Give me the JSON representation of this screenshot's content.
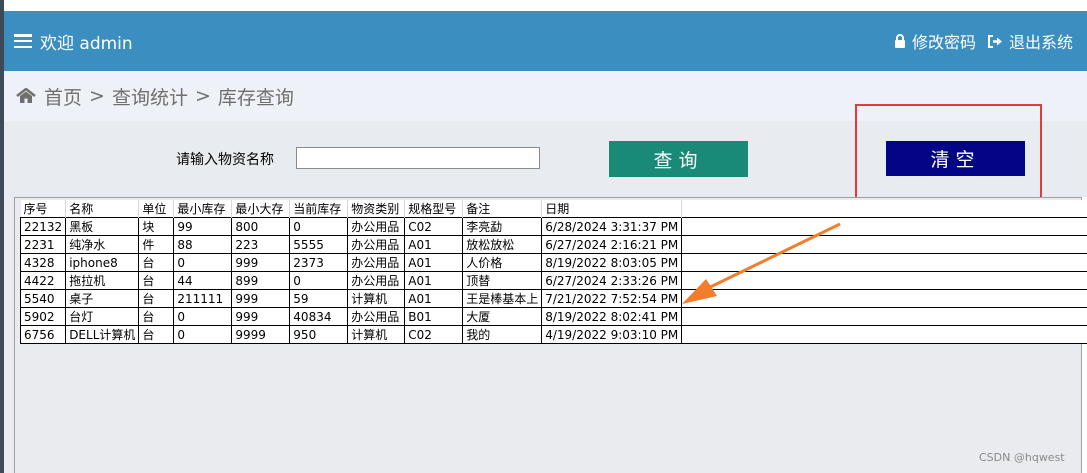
{
  "header": {
    "welcome": "欢迎 admin",
    "change_password": "修改密码",
    "logout": "退出系统"
  },
  "breadcrumb": [
    "首页",
    "查询统计",
    "库存查询"
  ],
  "breadcrumb_sep": ">",
  "search": {
    "label": "请输入物资名称",
    "value": "",
    "placeholder": "",
    "query_label": "查询",
    "clear_label": "清空"
  },
  "table": {
    "headers": [
      "序号",
      "名称",
      "单位",
      "最小库存",
      "最小大存",
      "当前库存",
      "物资类别",
      "规格型号",
      "备注",
      "日期"
    ],
    "rows": [
      [
        "22132",
        "黑板",
        "块",
        "99",
        "800",
        "0",
        "办公用品",
        "C02",
        "李亮勐",
        "6/28/2024 3:31:37 PM"
      ],
      [
        "2231",
        "纯净水",
        "件",
        "88",
        "223",
        "5555",
        "办公用品",
        "A01",
        "放松放松",
        "6/27/2024 2:16:21 PM"
      ],
      [
        "4328",
        "iphone8",
        "台",
        "0",
        "999",
        "2373",
        "办公用品",
        "A01",
        "人价格",
        "8/19/2022 8:03:05 PM"
      ],
      [
        "4422",
        "拖拉机",
        "台",
        "44",
        "899",
        "0",
        "办公用品",
        "A01",
        "顶替",
        "6/27/2024 2:33:26 PM"
      ],
      [
        "5540",
        "桌子",
        "台",
        "211111",
        "999",
        "59",
        "计算机",
        "A01",
        "王是棒基本上",
        "7/21/2022 7:52:54 PM"
      ],
      [
        "5902",
        "台灯",
        "台",
        "0",
        "999",
        "40834",
        "办公用品",
        "B01",
        "大厦",
        "8/19/2022 8:02:41 PM"
      ],
      [
        "6756",
        "DELL计算机",
        "台",
        "0",
        "9999",
        "950",
        "计算机",
        "C02",
        "我的",
        "4/19/2022 9:03:10 PM"
      ]
    ]
  },
  "watermark": "CSDN @hqwest",
  "colors": {
    "topbar": "#3a8fc0",
    "query_button": "#1a8a78",
    "clear_button": "#040486",
    "highlight_box": "#e53a3a",
    "arrow": "#f27d2c"
  },
  "icons": {
    "menu": "hamburger-icon",
    "home": "home-icon",
    "lock": "lock-icon",
    "logout": "sign-out-icon"
  }
}
